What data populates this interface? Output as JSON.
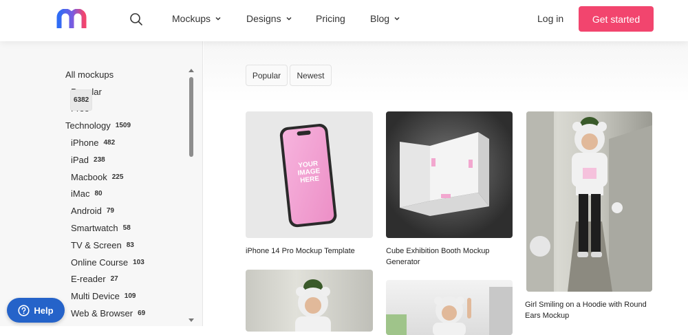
{
  "header": {
    "logo_icon": "mockup-m-logo",
    "brand_gradient": [
      "#2f6cf5",
      "#f2456e"
    ],
    "nav": [
      {
        "label": "Mockups",
        "has_dropdown": true
      },
      {
        "label": "Designs",
        "has_dropdown": true
      },
      {
        "label": "Pricing",
        "has_dropdown": false
      },
      {
        "label": "Blog",
        "has_dropdown": true
      }
    ],
    "login_label": "Log in",
    "cta_label": "Get started",
    "cta_color": "#f2456e"
  },
  "sidebar": {
    "categories": [
      {
        "label": "All mockups",
        "count": "6382",
        "level": 0,
        "active": true
      },
      {
        "label": "Popular",
        "count": "",
        "level": 1
      },
      {
        "label": "Free",
        "count": "",
        "level": 1
      },
      {
        "label": "Technology",
        "count": "1509",
        "level": 0
      },
      {
        "label": "iPhone",
        "count": "482",
        "level": 1
      },
      {
        "label": "iPad",
        "count": "238",
        "level": 1
      },
      {
        "label": "Macbook",
        "count": "225",
        "level": 1
      },
      {
        "label": "iMac",
        "count": "80",
        "level": 1
      },
      {
        "label": "Android",
        "count": "79",
        "level": 1
      },
      {
        "label": "Smartwatch",
        "count": "58",
        "level": 1
      },
      {
        "label": "TV & Screen",
        "count": "83",
        "level": 1
      },
      {
        "label": "Online Course",
        "count": "103",
        "level": 1
      },
      {
        "label": "E-reader",
        "count": "27",
        "level": 1
      },
      {
        "label": "Multi Device",
        "count": "109",
        "level": 1
      },
      {
        "label": "Web & Browser",
        "count": "69",
        "level": 1
      }
    ]
  },
  "help": {
    "label": "Help",
    "color": "#2563c9"
  },
  "filters": [
    {
      "label": "Popular"
    },
    {
      "label": "Newest"
    }
  ],
  "cards": [
    {
      "title": "iPhone 14 Pro Mockup Template",
      "screen_text": [
        "YOUR",
        "IMAGE",
        "HERE"
      ]
    },
    {
      "title": "Cube Exhibition Booth Mockup Generator"
    },
    {
      "title": "Girl Smiling on a Hoodie with Round Ears Mockup"
    },
    {
      "title": ""
    },
    {
      "title": ""
    }
  ]
}
